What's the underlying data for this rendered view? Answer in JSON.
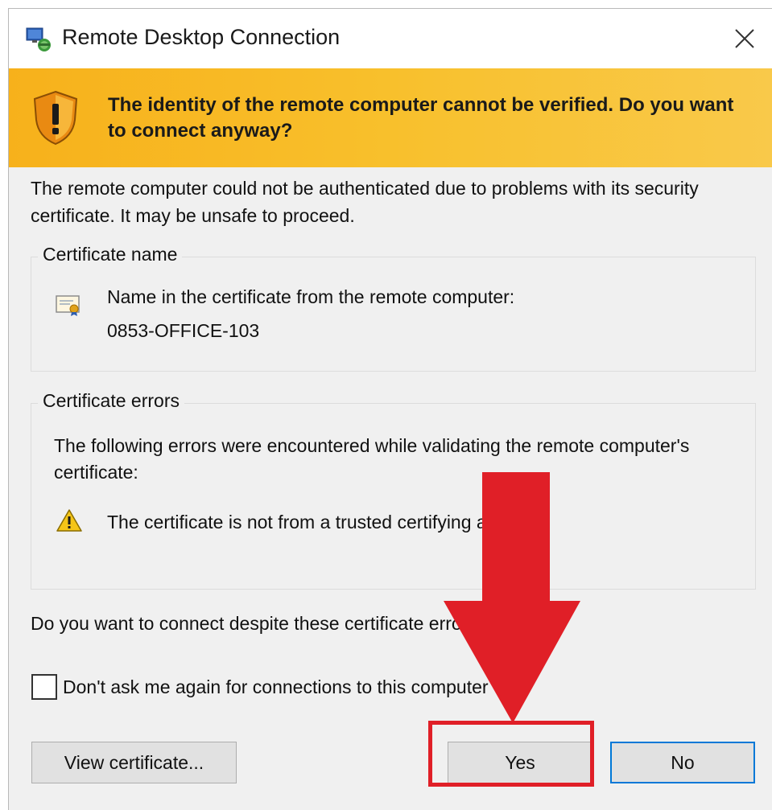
{
  "window": {
    "title": "Remote Desktop Connection",
    "icons": {
      "app": "remote-desktop-icon",
      "close": "close-icon"
    }
  },
  "banner": {
    "icon": "shield-warning-icon",
    "message": "The identity of the remote computer cannot be verified. Do you want to connect anyway?",
    "color": "#f8bd2a"
  },
  "intro": "The remote computer could not be authenticated due to problems with its security certificate. It may be unsafe to proceed.",
  "certificate_name": {
    "legend": "Certificate name",
    "icon": "certificate-icon",
    "label": "Name in the certificate from the remote computer:",
    "value": "0853-OFFICE-103"
  },
  "certificate_errors": {
    "legend": "Certificate errors",
    "intro": "The following errors were encountered while validating the remote computer's certificate:",
    "icon": "warning-icon",
    "items": [
      "The certificate is not from a trusted certifying authority."
    ]
  },
  "question": "Do you want to connect despite these certificate errors?",
  "dont_ask": {
    "label": "Don't ask me again for connections to this computer",
    "checked": false
  },
  "buttons": {
    "view": "View certificate...",
    "yes": "Yes",
    "no": "No"
  },
  "annotation": {
    "arrow_color": "#e01f27",
    "target": "Yes"
  }
}
